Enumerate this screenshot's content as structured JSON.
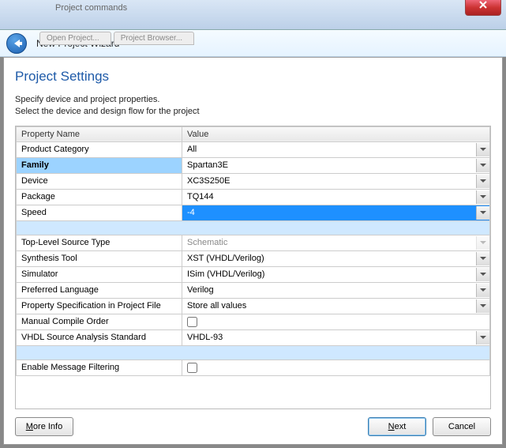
{
  "window": {
    "ghost_menu": "Project commands",
    "ghost_tabs": [
      "Open Project...",
      "Project Browser..."
    ],
    "title": "New Project Wizard"
  },
  "page": {
    "heading": "Project Settings",
    "sub1": "Specify device and project properties.",
    "sub2": "Select the device and design flow for the project"
  },
  "columns": {
    "name": "Property Name",
    "value": "Value"
  },
  "rows": [
    {
      "type": "combo",
      "name": "Product Category",
      "value": "All"
    },
    {
      "type": "combo",
      "name": "Family",
      "value": "Spartan3E",
      "selected": true
    },
    {
      "type": "combo",
      "name": "Device",
      "value": "XC3S250E"
    },
    {
      "type": "combo",
      "name": "Package",
      "value": "TQ144"
    },
    {
      "type": "combo",
      "name": "Speed",
      "value": "-4",
      "active": true
    },
    {
      "type": "group"
    },
    {
      "type": "combo",
      "name": "Top-Level Source Type",
      "value": "Schematic",
      "disabled": true
    },
    {
      "type": "combo",
      "name": "Synthesis Tool",
      "value": "XST (VHDL/Verilog)"
    },
    {
      "type": "combo",
      "name": "Simulator",
      "value": "ISim (VHDL/Verilog)"
    },
    {
      "type": "combo",
      "name": "Preferred Language",
      "value": "Verilog"
    },
    {
      "type": "combo",
      "name": "Property Specification in Project File",
      "value": "Store all values"
    },
    {
      "type": "check",
      "name": "Manual Compile Order",
      "checked": false
    },
    {
      "type": "combo",
      "name": "VHDL Source Analysis Standard",
      "value": "VHDL-93"
    },
    {
      "type": "group"
    },
    {
      "type": "check",
      "name": "Enable Message Filtering",
      "checked": false
    }
  ],
  "footer": {
    "more_info": "More Info",
    "next": "Next",
    "cancel": "Cancel"
  }
}
